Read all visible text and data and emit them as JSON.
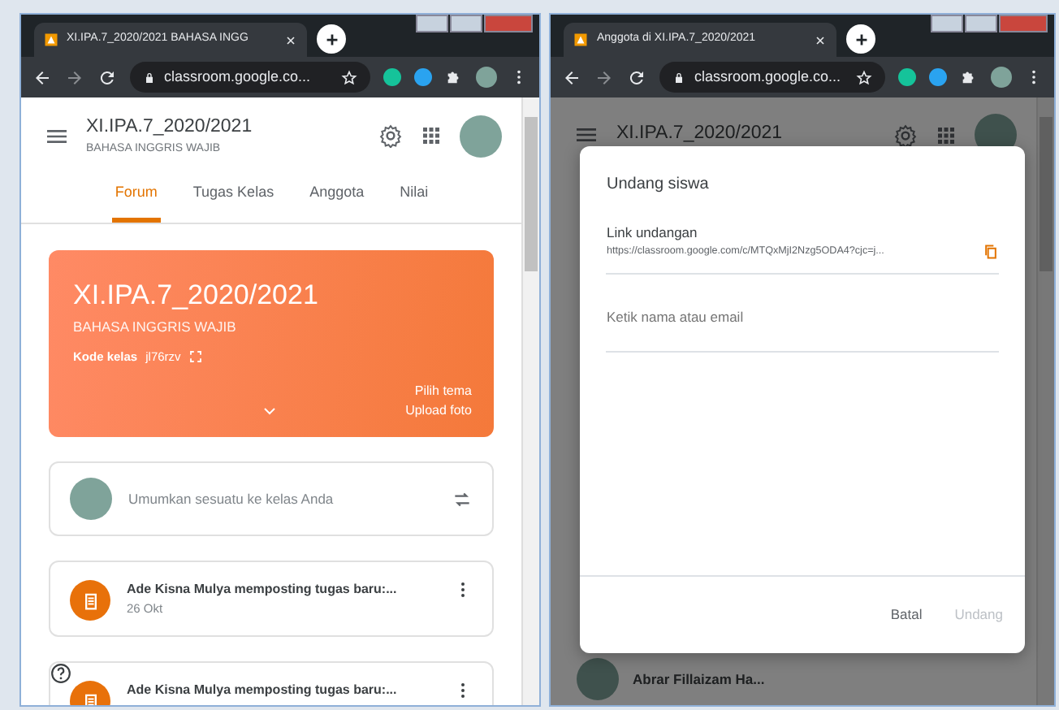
{
  "left_window": {
    "browser": {
      "tab_title": "XI.IPA.7_2020/2021 BAHASA INGG",
      "url": "classroom.google.co..."
    },
    "header": {
      "title": "XI.IPA.7_2020/2021",
      "subtitle": "BAHASA INGGRIS WAJIB"
    },
    "tabs": [
      {
        "label": "Forum",
        "selected": true
      },
      {
        "label": "Tugas Kelas",
        "selected": false
      },
      {
        "label": "Anggota",
        "selected": false
      },
      {
        "label": "Nilai",
        "selected": false
      }
    ],
    "banner": {
      "title": "XI.IPA.7_2020/2021",
      "subtitle": "BAHASA INGGRIS WAJIB",
      "code_label": "Kode kelas",
      "code": "jl76rzv",
      "links": [
        "Pilih tema",
        "Upload foto"
      ]
    },
    "announce": {
      "placeholder": "Umumkan sesuatu ke kelas Anda"
    },
    "posts": [
      {
        "text": "Ade Kisna Mulya memposting tugas baru:...",
        "date": "26 Okt"
      },
      {
        "text": "Ade Kisna Mulya memposting tugas baru:..."
      }
    ]
  },
  "right_window": {
    "browser": {
      "tab_title": "Anggota di XI.IPA.7_2020/2021",
      "url": "classroom.google.co..."
    },
    "header": {
      "title": "XI.IPA.7_2020/2021"
    },
    "member": {
      "name": "Abrar Fillaizam Ha..."
    },
    "dialog": {
      "title": "Undang siswa",
      "link_label": "Link undangan",
      "link_url": "https://classroom.google.com/c/MTQxMjI2Nzg5ODA4?cjc=j...",
      "invite_placeholder": "Ketik nama atau email",
      "buttons": [
        {
          "label": "Batal",
          "disabled": false
        },
        {
          "label": "Undang",
          "disabled": true
        }
      ]
    }
  }
}
